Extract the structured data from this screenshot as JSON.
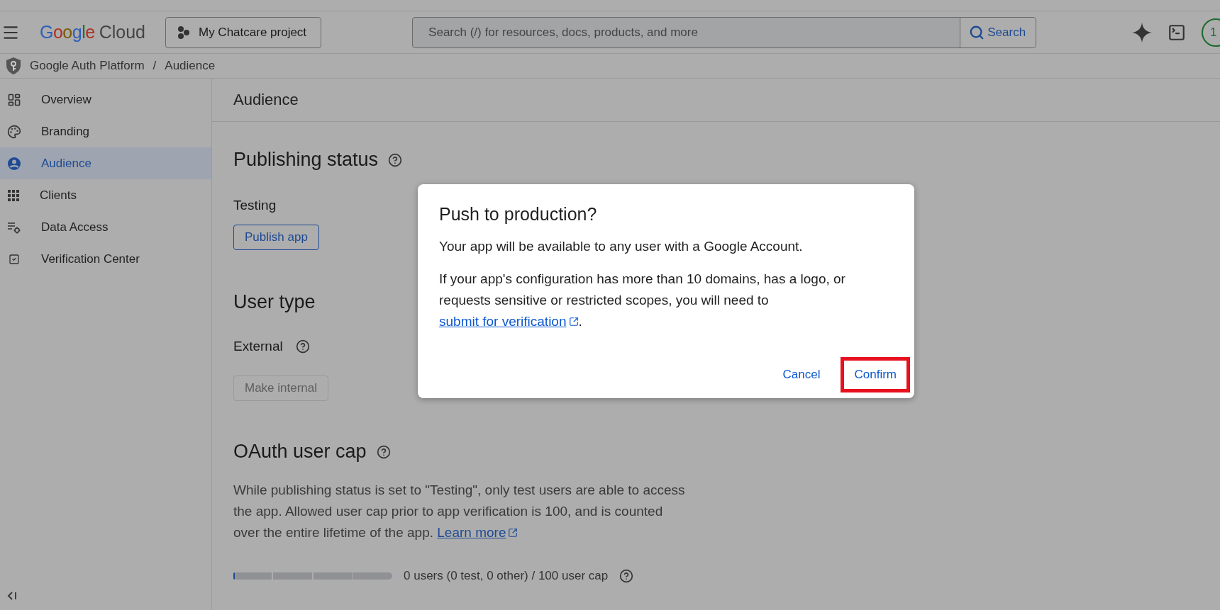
{
  "header": {
    "logo": {
      "brand": "Google",
      "product": "Cloud"
    },
    "project": "My Chatcare project",
    "search": {
      "placeholder": "Search (/) for resources, docs, products, and more",
      "button": "Search"
    },
    "avatar": "1"
  },
  "breadcrumb": {
    "items": [
      "Google Auth Platform",
      "Audience"
    ],
    "separator": "/"
  },
  "sidebar": {
    "items": [
      {
        "label": "Overview",
        "selected": false
      },
      {
        "label": "Branding",
        "selected": false
      },
      {
        "label": "Audience",
        "selected": true
      },
      {
        "label": "Clients",
        "selected": false
      },
      {
        "label": "Data Access",
        "selected": false
      },
      {
        "label": "Verification Center",
        "selected": false
      }
    ]
  },
  "page": {
    "title": "Audience",
    "publishing_status": {
      "title": "Publishing status",
      "status": "Testing",
      "button": {
        "label": "Publish app",
        "disabled": false
      }
    },
    "user_type": {
      "title": "User type",
      "value": "External",
      "button": {
        "label": "Make internal",
        "disabled": true
      }
    },
    "user_cap": {
      "title": "OAuth user cap",
      "text": "While publishing status is set to \"Testing\", only test users are able to access the app. Allowed user cap prior to app verification is 100, and is counted over the entire lifetime of the app.",
      "link": "Learn more",
      "level": 0,
      "reading": "0 users (0 test, 0 other) / 100 user cap"
    }
  },
  "dialog": {
    "title": "Push to production?",
    "paragraphs": [
      {
        "text": "Your app will be available to any user with a Google Account."
      },
      {
        "text": "If your app's configuration has more than 10 domains, has a logo, or requests sensitive or restricted scopes, you will need to",
        "link": "submit for verification",
        "after": "."
      }
    ],
    "buttons": [
      {
        "label": "Cancel",
        "highlighted": false
      },
      {
        "label": "Confirm",
        "highlighted": true
      }
    ]
  }
}
